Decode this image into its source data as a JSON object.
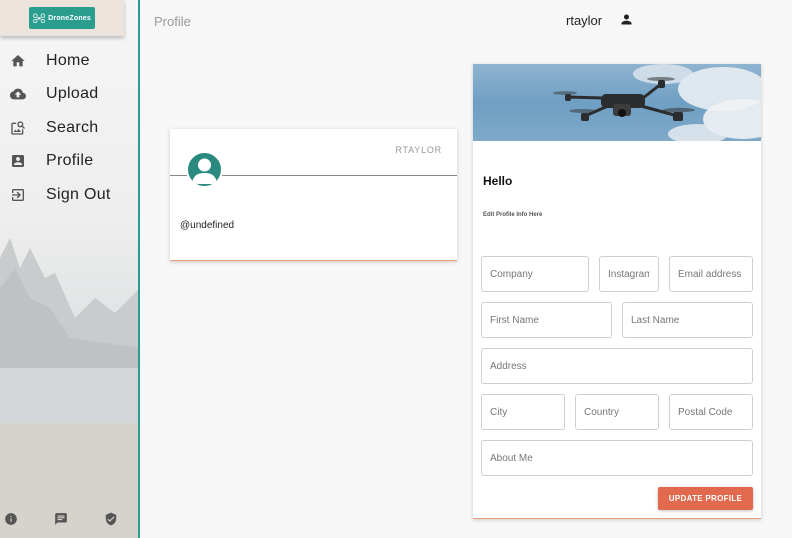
{
  "app": {
    "logo_text": "DroneZones"
  },
  "sidebar": {
    "items": [
      {
        "label": "Home",
        "icon": "home-icon"
      },
      {
        "label": "Upload",
        "icon": "cloud-upload-icon"
      },
      {
        "label": "Search",
        "icon": "image-search-icon"
      },
      {
        "label": "Profile",
        "icon": "account-box-icon"
      },
      {
        "label": "Sign Out",
        "icon": "exit-icon"
      }
    ],
    "bottom_icons": [
      "info-icon",
      "feedback-icon",
      "verified-icon"
    ]
  },
  "header": {
    "title": "Profile",
    "username": "rtaylor"
  },
  "profile_card": {
    "username_tag": "RTAYLOR",
    "handle": "@undefined"
  },
  "edit_card": {
    "greeting": "Hello",
    "subtitle": "Edit Profile Info Here",
    "fields": {
      "company": "Company",
      "instagram": "Instagram",
      "email": "Email address",
      "first_name": "First Name",
      "last_name": "Last Name",
      "address": "Address",
      "city": "City",
      "country": "Country",
      "postal_code": "Postal Code",
      "about_me": "About Me"
    },
    "submit_label": "UPDATE PROFILE"
  },
  "colors": {
    "accent": "#2a9d8f",
    "button": "#e1694e",
    "card_border": "#e7a27a"
  }
}
